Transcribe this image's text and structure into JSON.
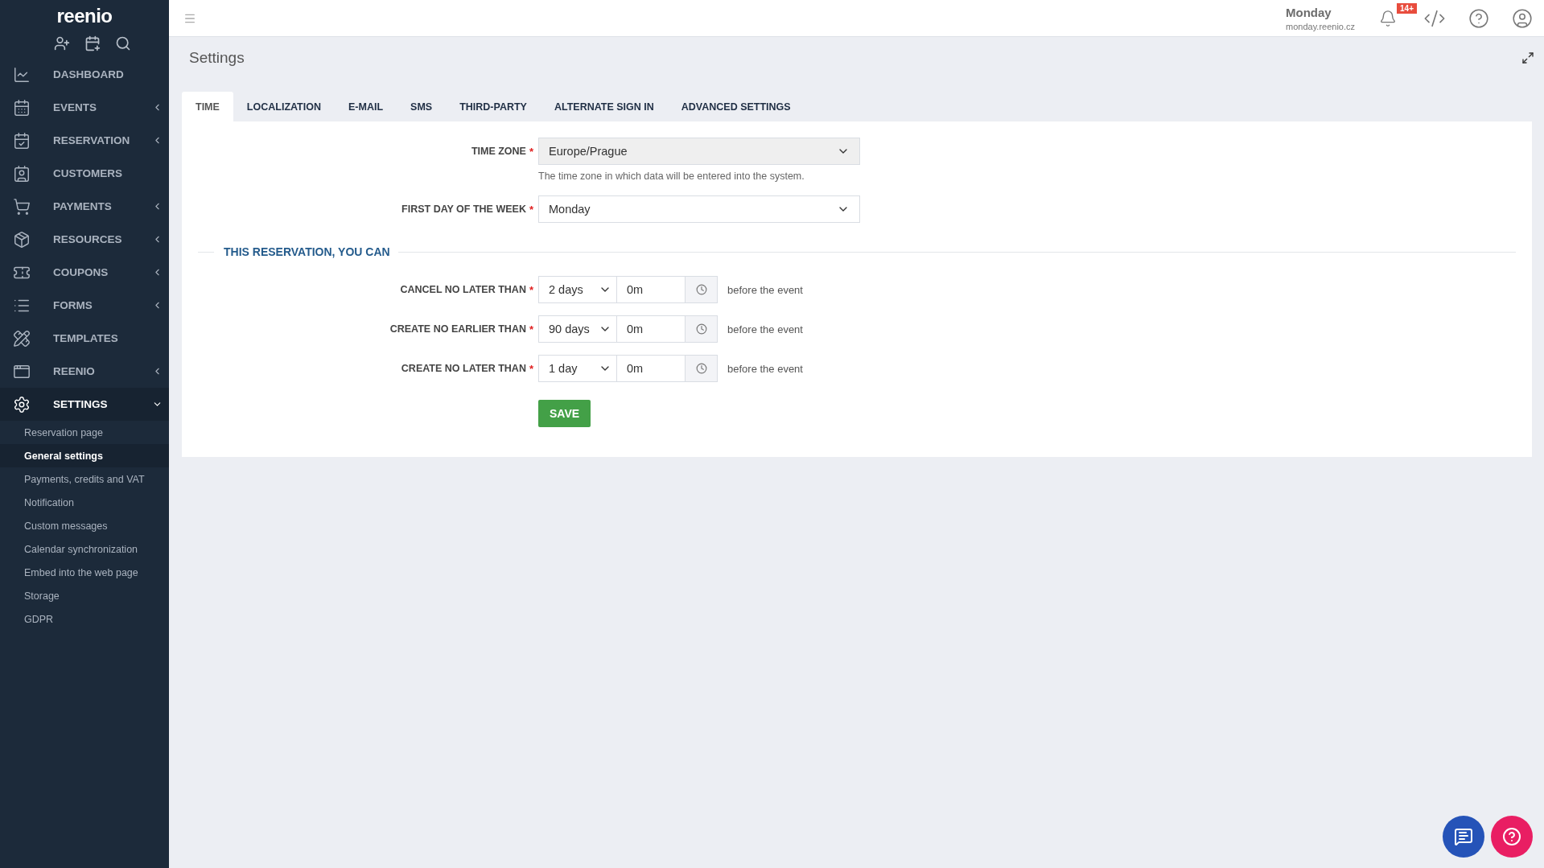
{
  "sidebar": {
    "logo": "reenio",
    "items": [
      {
        "label": "DASHBOARD",
        "submenu": false,
        "expanded": false,
        "selected": false
      },
      {
        "label": "EVENTS",
        "submenu": true,
        "expanded": false,
        "selected": false
      },
      {
        "label": "RESERVATION",
        "submenu": true,
        "expanded": false,
        "selected": false
      },
      {
        "label": "CUSTOMERS",
        "submenu": false,
        "expanded": false,
        "selected": false
      },
      {
        "label": "PAYMENTS",
        "submenu": true,
        "expanded": false,
        "selected": false
      },
      {
        "label": "RESOURCES",
        "submenu": true,
        "expanded": false,
        "selected": false
      },
      {
        "label": "COUPONS",
        "submenu": true,
        "expanded": false,
        "selected": false
      },
      {
        "label": "FORMS",
        "submenu": true,
        "expanded": false,
        "selected": false
      },
      {
        "label": "TEMPLATES",
        "submenu": false,
        "expanded": false,
        "selected": false
      },
      {
        "label": "REENIO",
        "submenu": true,
        "expanded": false,
        "selected": false
      },
      {
        "label": "SETTINGS",
        "submenu": true,
        "expanded": true,
        "selected": true,
        "children": [
          {
            "label": "Reservation page",
            "selected": false
          },
          {
            "label": "General settings",
            "selected": true
          },
          {
            "label": "Payments, credits and VAT",
            "selected": false
          },
          {
            "label": "Notification",
            "selected": false
          },
          {
            "label": "Custom messages",
            "selected": false
          },
          {
            "label": "Calendar synchronization",
            "selected": false
          },
          {
            "label": "Embed into the web page",
            "selected": false
          },
          {
            "label": "Storage",
            "selected": false
          },
          {
            "label": "GDPR",
            "selected": false
          }
        ]
      }
    ]
  },
  "header": {
    "account_name": "Monday",
    "account_domain": "monday.reenio.cz",
    "notification_badge": "14+"
  },
  "page": {
    "title": "Settings"
  },
  "tabs": [
    {
      "label": "TIME",
      "selected": true
    },
    {
      "label": "LOCALIZATION",
      "selected": false
    },
    {
      "label": "E-MAIL",
      "selected": false
    },
    {
      "label": "SMS",
      "selected": false
    },
    {
      "label": "THIRD-PARTY",
      "selected": false
    },
    {
      "label": "ALTERNATE SIGN IN",
      "selected": false
    },
    {
      "label": "ADVANCED SETTINGS",
      "selected": false
    }
  ],
  "fields": [
    {
      "label": "TIME ZONE",
      "required_mark": "*",
      "value": "Europe/Prague",
      "disabled": true,
      "hint": "The time zone in which data will be entered into the system."
    },
    {
      "label": "FIRST DAY OF THE WEEK",
      "required_mark": "*",
      "value": "Monday",
      "disabled": false
    }
  ],
  "section": {
    "title": "THIS RESERVATION, YOU CAN",
    "rows": [
      {
        "label": "CANCEL NO LATER THAN",
        "required_mark": "*",
        "days": "2 days",
        "time": "0m",
        "suffix": "before the event"
      },
      {
        "label": "CREATE NO EARLIER THAN",
        "required_mark": "*",
        "days": "90 days",
        "time": "0m",
        "suffix": "before the event"
      },
      {
        "label": "CREATE NO LATER THAN",
        "required_mark": "*",
        "days": "1 day",
        "time": "0m",
        "suffix": "before the event"
      }
    ]
  },
  "save_button": "SAVE"
}
